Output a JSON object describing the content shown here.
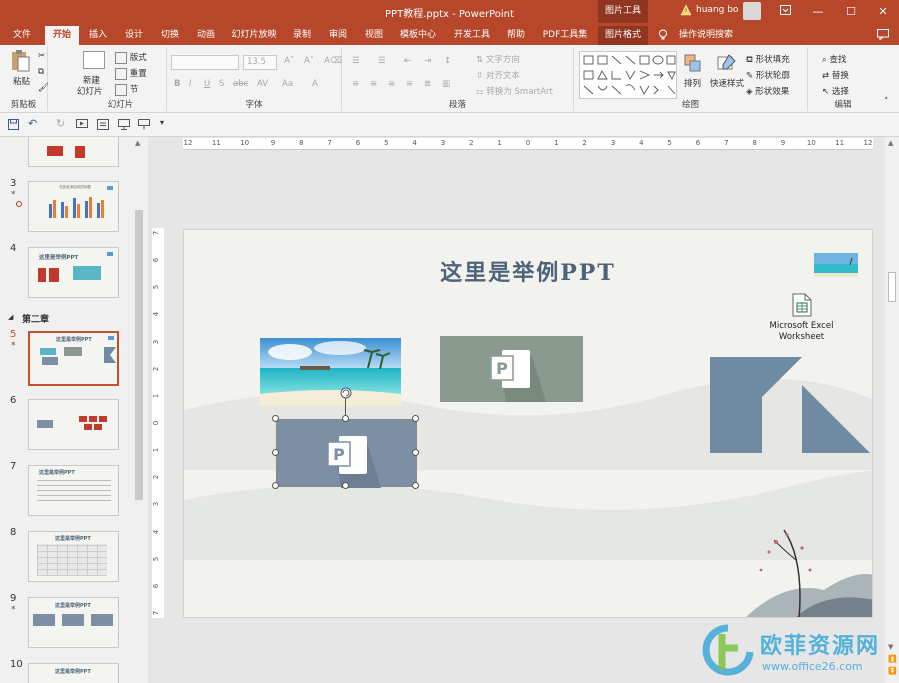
{
  "titlebar": {
    "title": "PPT教程.pptx  -  PowerPoint",
    "context_tab": "图片工具",
    "user": "huang bo",
    "min": "—",
    "restore": "☐",
    "close": "✕"
  },
  "tabs": [
    {
      "label": "文件"
    },
    {
      "label": "开始"
    },
    {
      "label": "插入"
    },
    {
      "label": "设计"
    },
    {
      "label": "切换"
    },
    {
      "label": "动画"
    },
    {
      "label": "幻灯片放映"
    },
    {
      "label": "录制"
    },
    {
      "label": "审阅"
    },
    {
      "label": "视图"
    },
    {
      "label": "模板中心"
    },
    {
      "label": "开发工具"
    },
    {
      "label": "帮助"
    },
    {
      "label": "PDF工具集"
    },
    {
      "label": "图片格式"
    },
    {
      "label": "操作说明搜索"
    }
  ],
  "ribbon": {
    "clipboard": {
      "paste": "粘贴",
      "group": "剪贴板"
    },
    "slides": {
      "new_slide_1": "新建",
      "new_slide_2": "幻灯片",
      "layout": "版式",
      "reset": "重置",
      "section": "节",
      "group": "幻灯片"
    },
    "font": {
      "font_name": "",
      "font_size": "13.5",
      "bold": "B",
      "italic": "I",
      "underline": "U",
      "shadow": "S",
      "strike": "abc",
      "spacing": "AV",
      "case": "Aa",
      "group": "字体"
    },
    "paragraph": {
      "text_direction": "文字方向",
      "align_text": "对齐文本",
      "smartart": "转换为 SmartArt",
      "group": "段落"
    },
    "drawing": {
      "arrange": "排列",
      "quick_styles": "快速样式",
      "fill": "形状填充",
      "outline": "形状轮廓",
      "effects": "形状效果",
      "group": "绘图"
    },
    "editing": {
      "find": "查找",
      "replace": "替换",
      "select": "选择",
      "group": "编辑"
    }
  },
  "panel": {
    "section_label": "第二章",
    "slides": [
      {
        "num": "3",
        "star": "*",
        "title": "在此处添加你的标题"
      },
      {
        "num": "4",
        "star": "",
        "title": "这里是举例PPT"
      },
      {
        "num": "5",
        "star": "*",
        "title": "这里是举例PPT"
      },
      {
        "num": "6",
        "star": "",
        "title": ""
      },
      {
        "num": "7",
        "star": "",
        "title": "这里是举例PPT"
      },
      {
        "num": "8",
        "star": "",
        "title": "这里是举例PPT"
      },
      {
        "num": "9",
        "star": "*",
        "title": "这里是举例PPT"
      },
      {
        "num": "10",
        "star": "",
        "title": "这里是举例PPT"
      }
    ]
  },
  "ruler": {
    "h_ticks": [
      "12",
      "11",
      "10",
      "9",
      "8",
      "7",
      "6",
      "5",
      "4",
      "3",
      "2",
      "1",
      "0",
      "1",
      "2",
      "3",
      "4",
      "5",
      "6",
      "7",
      "8",
      "9",
      "10",
      "11",
      "12"
    ],
    "v_ticks": [
      "7",
      "6",
      "5",
      "4",
      "3",
      "2",
      "1",
      "0",
      "1",
      "2",
      "3",
      "4",
      "5",
      "6",
      "7"
    ]
  },
  "slide": {
    "title": "这里是举例PPT",
    "excel_label_1": "Microsoft Excel",
    "excel_label_2": "Worksheet"
  },
  "watermark": {
    "brand": "欧菲资源网",
    "url": "www.office26.com"
  },
  "colors": {
    "accent": "#b7472a",
    "selected": "#c5502c",
    "ppt_gray": "#8a9a8e",
    "ppt_blue": "#7d8fa5",
    "shape_blue": "#6f8aa3"
  }
}
